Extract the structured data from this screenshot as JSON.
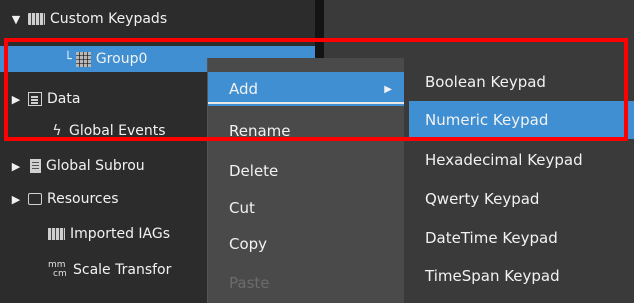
{
  "tree": {
    "items": [
      {
        "label": "Custom Keypads",
        "arrow": "▼"
      },
      {
        "label": "Group0",
        "elbow": "└"
      },
      {
        "label": "Data",
        "arrow": "▶"
      },
      {
        "label": "Global Events",
        "icon": "ϟ"
      },
      {
        "label": "Global Subrou",
        "arrow": "▶"
      },
      {
        "label": "Resources",
        "arrow": "▶"
      },
      {
        "label": "Imported IAGs"
      },
      {
        "label": "Scale Transfor"
      }
    ]
  },
  "context_menu": {
    "items": [
      {
        "label": "Add",
        "arrow": "▶"
      },
      {
        "label": "Rename"
      },
      {
        "label": "Delete"
      },
      {
        "label": "Cut"
      },
      {
        "label": "Copy"
      },
      {
        "label": "Paste"
      }
    ]
  },
  "submenu": {
    "items": [
      {
        "label": "Boolean Keypad"
      },
      {
        "label": "Numeric Keypad"
      },
      {
        "label": "Hexadecimal Keypad"
      },
      {
        "label": "Qwerty Keypad"
      },
      {
        "label": "DateTime Keypad"
      },
      {
        "label": "TimeSpan Keypad"
      }
    ]
  },
  "icons": {
    "scale_top": "mm",
    "scale_bottom": "cm"
  },
  "colors": {
    "selection": "#3f8fd2",
    "highlight": "#ff0000"
  }
}
